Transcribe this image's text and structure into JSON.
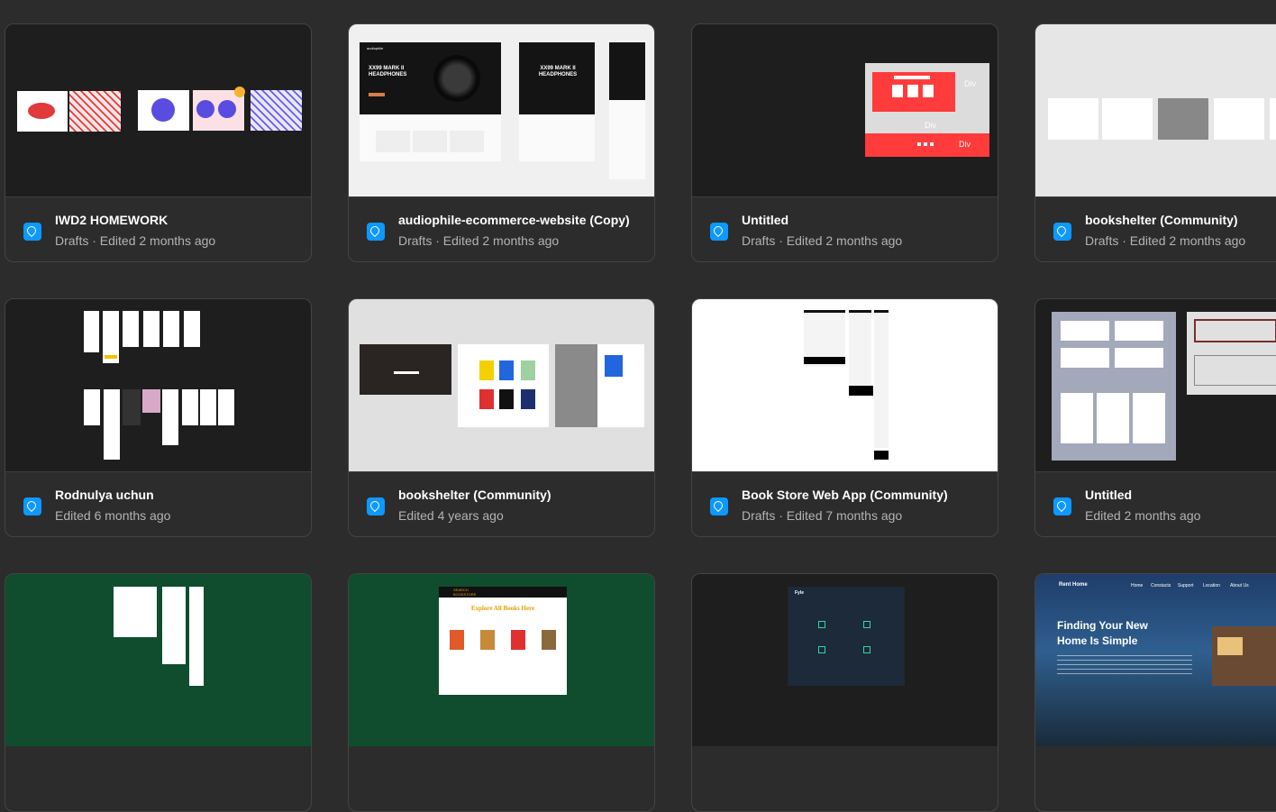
{
  "files": [
    {
      "title": "IWD2 HOMEWORK",
      "meta": "Drafts · Edited 2 months ago"
    },
    {
      "title": "audiophile-ecommerce-website (Copy)",
      "meta": "Drafts · Edited 2 months ago"
    },
    {
      "title": "Untitled",
      "meta": "Drafts · Edited 2 months ago"
    },
    {
      "title": "bookshelter (Community)",
      "meta": "Drafts · Edited 2 months ago"
    },
    {
      "title": "Rodnulya uchun",
      "meta": "Edited 6 months ago"
    },
    {
      "title": "bookshelter (Community)",
      "meta": "Edited 4 years ago"
    },
    {
      "title": "Book Store Web App (Community)",
      "meta": "Drafts · Edited 7 months ago"
    },
    {
      "title": "Untitled",
      "meta": "Edited 2 months ago"
    }
  ],
  "thumb_text": {
    "audiophile_brand": "audiophile",
    "audiophile_headline": "XX99 MARK II HEADPHONES",
    "div_label": "Div",
    "books_heading": "Explore All Books Here",
    "books_brand": "SEARCH BOOKSTORE",
    "fyle_brand": "Fyle",
    "rent_brand": "Rent Home",
    "rent_nav": [
      "Home",
      "Constacts",
      "Support",
      "Location",
      "About Us"
    ],
    "rent_headline_1": "Finding Your New",
    "rent_headline_2": "Home Is Simple"
  },
  "colors": {
    "accent": "#0d99ff",
    "bg": "#2c2c2c",
    "card_border": "#444444"
  }
}
